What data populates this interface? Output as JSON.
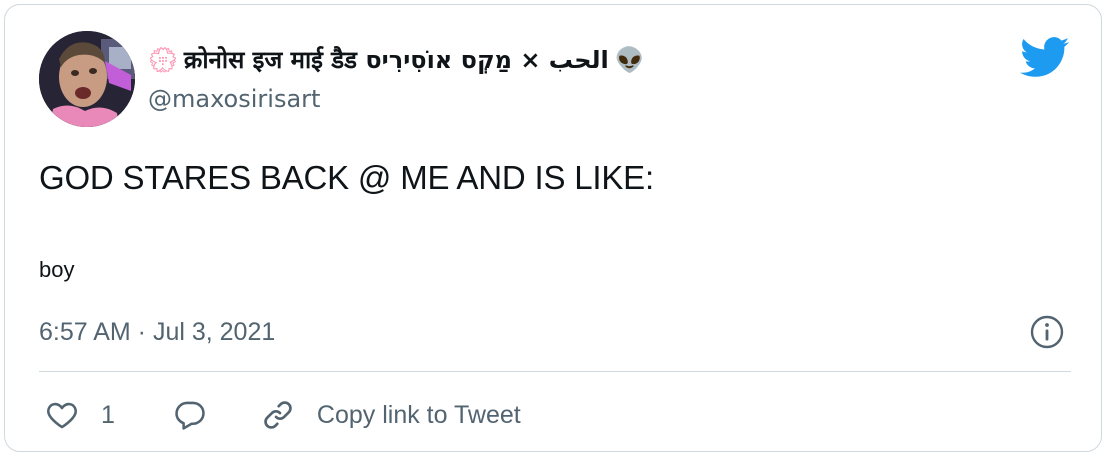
{
  "author": {
    "display_name": "क्रोनोस इज माई डैड الحب × מַקְס אוֹסִירִיס",
    "leading_emoji": "💮",
    "trailing_emoji": "👽",
    "handle": "@maxosirisart",
    "avatar_icon": "avatar"
  },
  "tweet": {
    "text": "GOD STARES BACK @ ME AND IS LIKE:",
    "subtext": "boy",
    "timestamp": "6:57 AM · Jul 3, 2021"
  },
  "actions": {
    "like_count": "1",
    "copy_link_label": "Copy link to Tweet"
  },
  "colors": {
    "twitter_blue": "#1d9bf0",
    "secondary_text": "#536471",
    "border": "#cfd9de"
  }
}
